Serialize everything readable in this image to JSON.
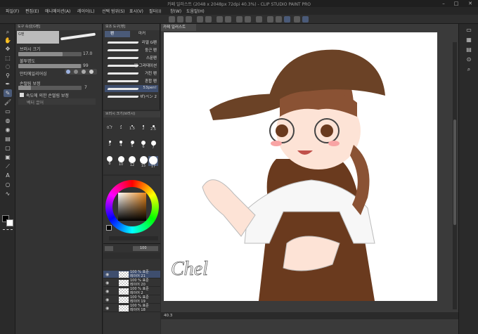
{
  "title": "카페 일러스트 (2048 x 2048px 72dpi 40.3%) - CLIP STUDIO PAINT PRO",
  "menu": [
    "파일(F)",
    "편집(E)",
    "애니메이션(A)",
    "레이어(L)",
    "선택 범위(S)",
    "표시(V)",
    "필터(I)",
    "창(W)",
    "도움말(H)"
  ],
  "tool_property": {
    "tab_label": "도구 속성[G펜]",
    "brush_name": "G펜",
    "brush_size_label": "브러시 크기",
    "brush_size_value": "17.0",
    "opacity_label": "불투명도",
    "opacity_value": "99",
    "opacity_level": 0.99,
    "antialias_label": "안티에일리어싱",
    "stabilization_label": "손떨림 보정",
    "stabilization_value": "7",
    "speed_label": "속도에 의한 손떨림 보정",
    "vector_label": "벡터 끌어"
  },
  "subtool": {
    "tab_label": "보조 도구[펜]",
    "group_pen": "펜",
    "group_marker": "마커",
    "brushes": [
      "리얼 G펜",
      "둥근 펜",
      "스푼펜",
      "펜 그라데이션",
      "거친 펜",
      "혼합 펜",
      "53pen!",
      "ぜ(ベン 2"
    ]
  },
  "brush_size_panel": {
    "tab_label": "브러시 크기(브러시)",
    "sizes": [
      "0.7",
      "1",
      "1.5",
      "2",
      "2.5",
      "3",
      "4",
      "5",
      "6",
      "7",
      "8",
      "10",
      "12",
      "15",
      "17"
    ]
  },
  "layers": {
    "opacity_value": "100",
    "rows": [
      {
        "blend": "100 % 표준",
        "name": "레이어 21"
      },
      {
        "blend": "100 % 표준",
        "name": "레이어 20"
      },
      {
        "blend": "100 % 표준",
        "name": "레이어 2"
      },
      {
        "blend": "100 % 표준",
        "name": "레이어 19"
      },
      {
        "blend": "100 % 표준",
        "name": "레이어 18"
      }
    ]
  },
  "document_tab": "카페 일러스트",
  "status": {
    "zoom": "40.3"
  },
  "canvas_signature": "Chel",
  "colors": {
    "accent": "#4a5a78",
    "hat": "#6b4226",
    "hair": "#8a5234",
    "apron": "#6a3a1e",
    "skin": "#fde3d6"
  },
  "icons": {
    "tools": [
      "zoom-icon",
      "hand-icon",
      "move-icon",
      "select-icon",
      "lasso-icon",
      "eyedropper-icon",
      "pen-icon",
      "pencil-icon",
      "brush-icon",
      "eraser-icon",
      "blend-icon",
      "fill-icon",
      "gradient-icon",
      "figure-icon",
      "frame-icon",
      "ruler-icon",
      "text-icon",
      "balloon-icon",
      "correction-icon"
    ]
  }
}
